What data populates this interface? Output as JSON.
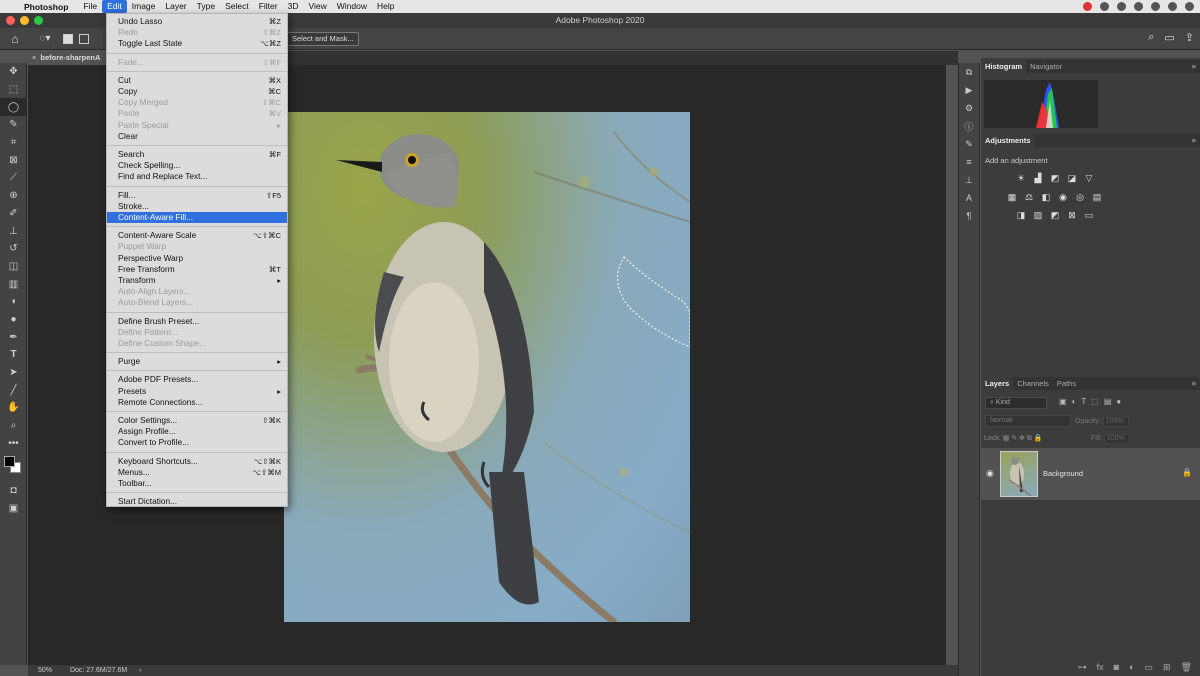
{
  "menubar": {
    "app_name": "Photoshop",
    "items": [
      "File",
      "Edit",
      "Image",
      "Layer",
      "Type",
      "Select",
      "Filter",
      "3D",
      "View",
      "Window",
      "Help"
    ]
  },
  "window": {
    "title": "Adobe Photoshop 2020"
  },
  "options_bar": {
    "select_mask_label": "Select and Mask..."
  },
  "document": {
    "tab_title": "before-sharpenA",
    "zoom": "50%",
    "doc_size": "Doc: 27.6M/27.6M"
  },
  "edit_menu": {
    "items": [
      {
        "label": "Undo Lasso",
        "shortcut": "⌘Z",
        "disabled": false
      },
      {
        "label": "Redo",
        "shortcut": "⇧⌘Z",
        "disabled": true
      },
      {
        "label": "Toggle Last State",
        "shortcut": "⌥⌘Z",
        "disabled": false
      },
      {
        "sep": true
      },
      {
        "label": "Fade...",
        "shortcut": "⇧⌘F",
        "disabled": true
      },
      {
        "sep": true
      },
      {
        "label": "Cut",
        "shortcut": "⌘X",
        "disabled": false
      },
      {
        "label": "Copy",
        "shortcut": "⌘C",
        "disabled": false
      },
      {
        "label": "Copy Merged",
        "shortcut": "⇧⌘C",
        "disabled": true
      },
      {
        "label": "Paste",
        "shortcut": "⌘V",
        "disabled": true
      },
      {
        "label": "Paste Special",
        "shortcut": "▸",
        "disabled": true
      },
      {
        "label": "Clear",
        "shortcut": "",
        "disabled": false
      },
      {
        "sep": true
      },
      {
        "label": "Search",
        "shortcut": "⌘F",
        "disabled": false
      },
      {
        "label": "Check Spelling...",
        "shortcut": "",
        "disabled": false
      },
      {
        "label": "Find and Replace Text...",
        "shortcut": "",
        "disabled": false
      },
      {
        "sep": true
      },
      {
        "label": "Fill...",
        "shortcut": "⇧F5",
        "disabled": false
      },
      {
        "label": "Stroke...",
        "shortcut": "",
        "disabled": false
      },
      {
        "label": "Content-Aware Fill...",
        "shortcut": "",
        "disabled": false,
        "highlight": true
      },
      {
        "sep": true
      },
      {
        "label": "Content-Aware Scale",
        "shortcut": "⌥⇧⌘C",
        "disabled": false
      },
      {
        "label": "Puppet Warp",
        "shortcut": "",
        "disabled": true
      },
      {
        "label": "Perspective Warp",
        "shortcut": "",
        "disabled": false
      },
      {
        "label": "Free Transform",
        "shortcut": "⌘T",
        "disabled": false
      },
      {
        "label": "Transform",
        "shortcut": "▸",
        "disabled": false
      },
      {
        "label": "Auto-Align Layers...",
        "shortcut": "",
        "disabled": true
      },
      {
        "label": "Auto-Blend Layers...",
        "shortcut": "",
        "disabled": true
      },
      {
        "sep": true
      },
      {
        "label": "Define Brush Preset...",
        "shortcut": "",
        "disabled": false
      },
      {
        "label": "Define Pattern...",
        "shortcut": "",
        "disabled": true
      },
      {
        "label": "Define Custom Shape...",
        "shortcut": "",
        "disabled": true
      },
      {
        "sep": true
      },
      {
        "label": "Purge",
        "shortcut": "▸",
        "disabled": false
      },
      {
        "sep": true
      },
      {
        "label": "Adobe PDF Presets...",
        "shortcut": "",
        "disabled": false
      },
      {
        "label": "Presets",
        "shortcut": "▸",
        "disabled": false
      },
      {
        "label": "Remote Connections...",
        "shortcut": "",
        "disabled": false
      },
      {
        "sep": true
      },
      {
        "label": "Color Settings...",
        "shortcut": "⇧⌘K",
        "disabled": false
      },
      {
        "label": "Assign Profile...",
        "shortcut": "",
        "disabled": false
      },
      {
        "label": "Convert to Profile...",
        "shortcut": "",
        "disabled": false
      },
      {
        "sep": true
      },
      {
        "label": "Keyboard Shortcuts...",
        "shortcut": "⌥⇧⌘K",
        "disabled": false
      },
      {
        "label": "Menus...",
        "shortcut": "⌥⇧⌘M",
        "disabled": false
      },
      {
        "label": "Toolbar...",
        "shortcut": "",
        "disabled": false
      },
      {
        "sep": true
      },
      {
        "label": "Start Dictation...",
        "shortcut": "",
        "disabled": false
      }
    ]
  },
  "panels": {
    "top_tabs": [
      "Histogram",
      "Navigator"
    ],
    "adjustments_tab": "Adjustments",
    "adjustments_hint": "Add an adjustment",
    "layers_tabs": [
      "Layers",
      "Channels",
      "Paths"
    ],
    "layers_filter": "Kind",
    "blend_mode": "Normal",
    "opacity_label": "Opacity:",
    "opacity_value": "100%",
    "lock_label": "Lock:",
    "fill_label": "Fill:",
    "fill_value": "100%",
    "layer_name": "Background"
  },
  "colors": {
    "highlight": "#2f6fde",
    "menu_bg": "#dcdcdc",
    "canvas_bg": "#282828"
  }
}
